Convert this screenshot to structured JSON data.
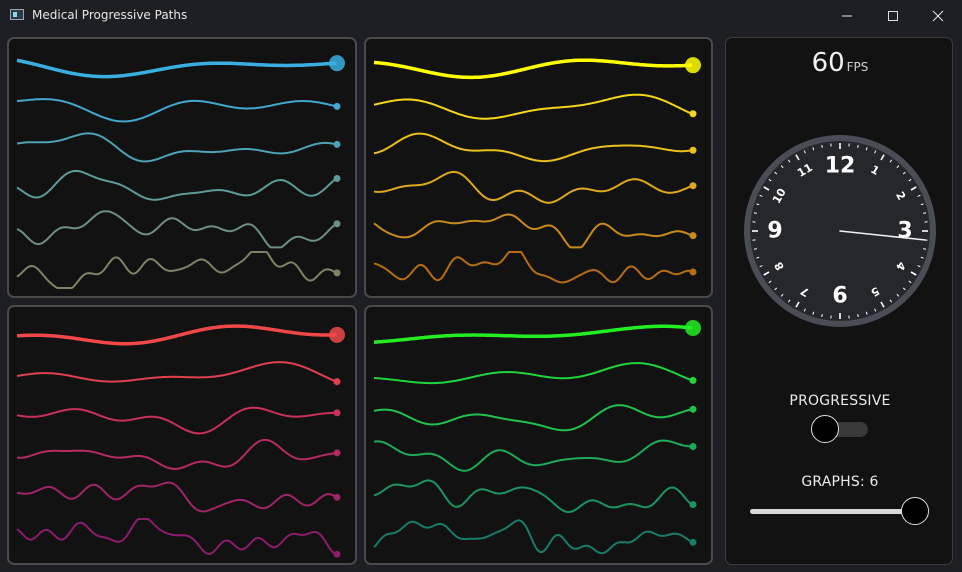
{
  "window": {
    "title": "Medical Progressive Paths",
    "controls": [
      "minimize-icon",
      "maximize-icon",
      "close-icon"
    ]
  },
  "fps": {
    "value": "60",
    "unit": "FPS"
  },
  "clock": {
    "numerals": [
      "12",
      "1",
      "2",
      "3",
      "4",
      "5",
      "6",
      "7",
      "8",
      "9",
      "10",
      "11"
    ],
    "hand_minutes": 16
  },
  "progressive": {
    "label": "PROGRESSIVE",
    "on": false
  },
  "graphs": {
    "label": "GRAPHS: 6",
    "count": 6,
    "slider_fraction": 1.0
  },
  "panels": [
    {
      "name": "panel-blue",
      "colors": [
        "#3aaee0",
        "#42a8cf",
        "#4fa2b4",
        "#5f9a98",
        "#6e9080",
        "#7b8466"
      ]
    },
    {
      "name": "panel-yellow",
      "colors": [
        "#ffff00",
        "#f5d61a",
        "#ebbf1e",
        "#dea81f",
        "#c98a1c",
        "#b56e16"
      ]
    },
    {
      "name": "panel-red",
      "colors": [
        "#f04848",
        "#e04050",
        "#c8305a",
        "#b42a62",
        "#a02468",
        "#8c1c6c"
      ]
    },
    {
      "name": "panel-green",
      "colors": [
        "#22ee22",
        "#22d43c",
        "#22c04c",
        "#1eaa58",
        "#1c9462",
        "#1a7c68"
      ]
    }
  ]
}
